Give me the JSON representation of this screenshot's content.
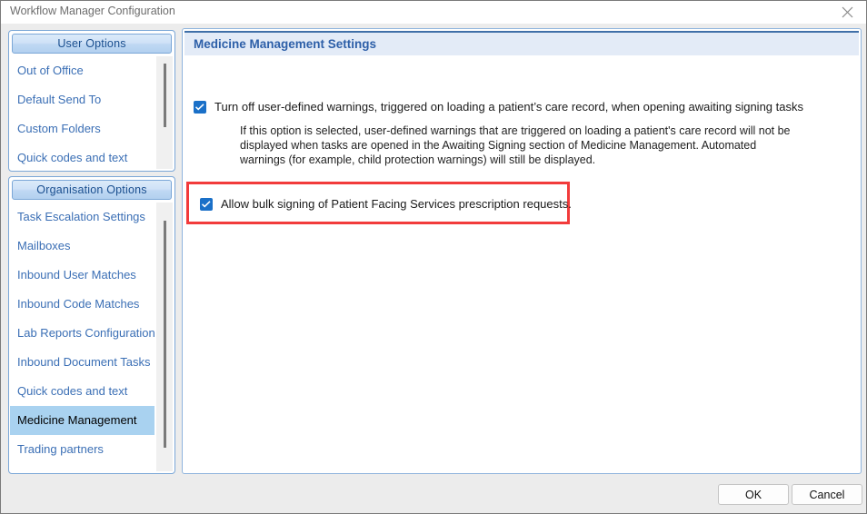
{
  "window": {
    "title": "Workflow Manager Configuration",
    "close_icon": "close-icon"
  },
  "sidebar": {
    "sections": [
      {
        "header": "User Options",
        "items": [
          {
            "label": "Out of Office",
            "selected": false
          },
          {
            "label": "Default Send To",
            "selected": false
          },
          {
            "label": "Custom Folders",
            "selected": false
          },
          {
            "label": "Quick codes and text",
            "selected": false
          }
        ]
      },
      {
        "header": "Organisation Options",
        "items": [
          {
            "label": "Task Escalation Settings",
            "selected": false
          },
          {
            "label": "Mailboxes",
            "selected": false
          },
          {
            "label": "Inbound User Matches",
            "selected": false
          },
          {
            "label": "Inbound Code Matches",
            "selected": false
          },
          {
            "label": "Lab Reports Configuration",
            "selected": false
          },
          {
            "label": "Inbound Document Tasks",
            "selected": false
          },
          {
            "label": "Quick codes and text",
            "selected": false
          },
          {
            "label": "Medicine Management",
            "selected": true
          },
          {
            "label": "Trading partners",
            "selected": false
          }
        ]
      }
    ]
  },
  "main": {
    "header": "Medicine Management Settings",
    "option_warnings": {
      "label": "Turn off user-defined warnings, triggered on loading a patient’s care record, when opening awaiting signing tasks",
      "checked": true,
      "description": "If this option is selected, user-defined warnings that are triggered on loading a patient's care record will not be displayed when tasks are opened in the Awaiting Signing section of Medicine Management. Automated warnings (for example, child protection warnings) will still be displayed."
    },
    "option_bulk_signing": {
      "label": "Allow bulk signing of Patient Facing Services prescription requests.",
      "checked": true,
      "highlight_color": "#f23b3b"
    }
  },
  "footer": {
    "ok_label": "OK",
    "cancel_label": "Cancel"
  },
  "colors": {
    "accent": "#2d5fa8",
    "link": "#3b6fb5",
    "selection": "#a9d2f0",
    "checkbox": "#1a70c8",
    "highlight": "#f23b3b"
  }
}
